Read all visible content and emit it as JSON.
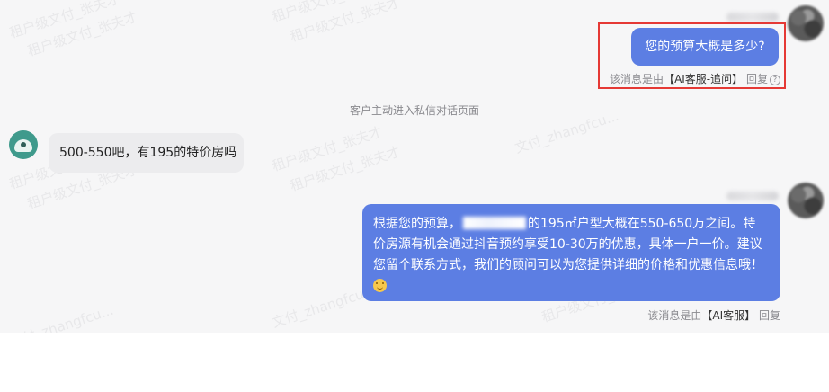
{
  "watermark": {
    "line1": "租户级文付_张夫才",
    "line2": "文付_zhangfcu..."
  },
  "messages": [
    {
      "text": "您的预算大概是多少?",
      "meta_prefix": "该消息是由",
      "meta_tag": "【AI客服-追问】",
      "meta_action": "回复"
    },
    {
      "system_note": "客户主动进入私信对话页面"
    },
    {
      "text": "500-550吧，有195的特价房吗"
    },
    {
      "text_before_redaction": "根据您的预算，",
      "text_after_redaction": "的195㎡户型大概在550-650万之间。特价房源有机会通过抖音预约享受10-30万的优惠，具体一户一价。建议您留个联系方式，我们的顾问可以为您提供详细的价格和优惠信息哦！",
      "emoji": "smiley-emoji-icon",
      "meta_prefix": "该消息是由",
      "meta_tag": "【AI客服】",
      "meta_action": "回复"
    }
  ],
  "colors": {
    "agent_bubble": "#5c7ee3",
    "customer_bubble": "#ececee",
    "highlight_box": "#e53935",
    "chat_background": "#f6f6f7"
  }
}
